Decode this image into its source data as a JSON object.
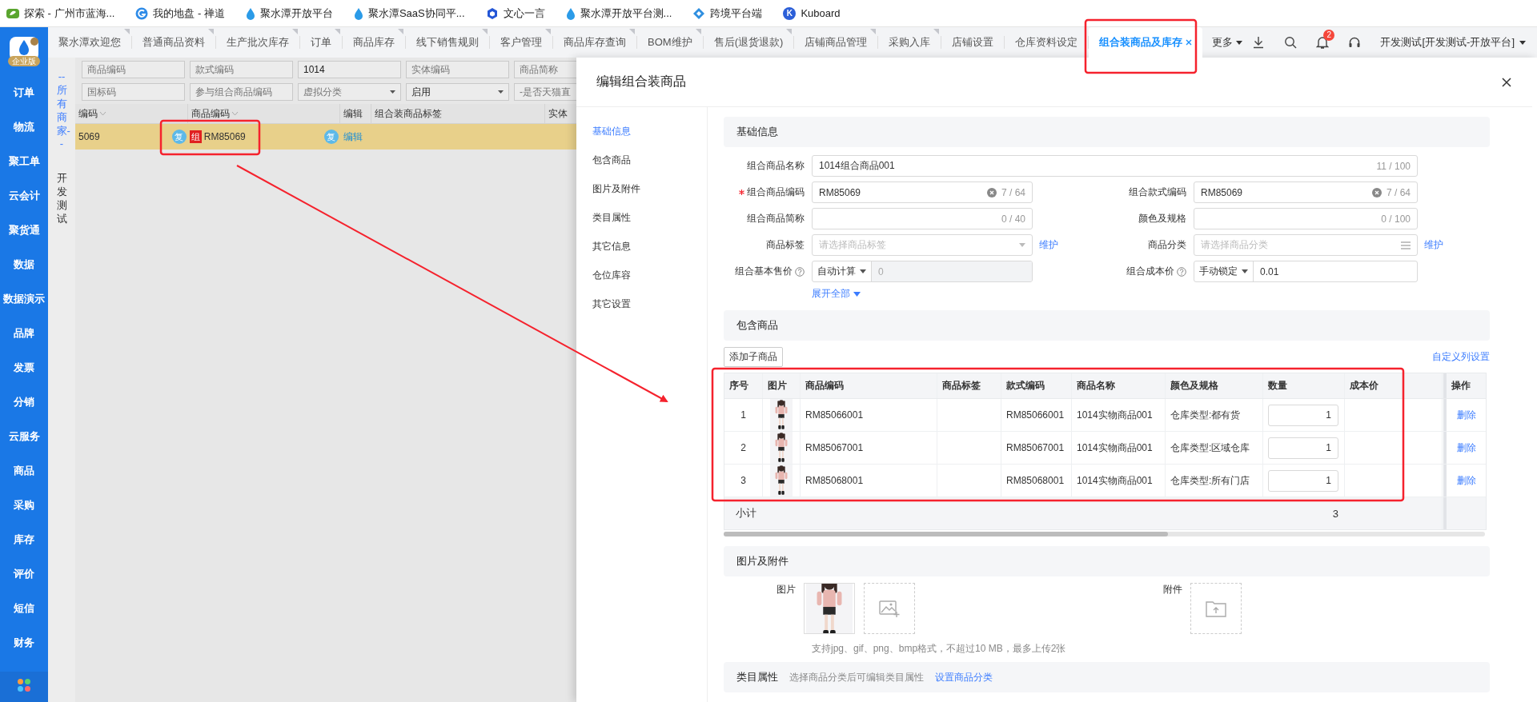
{
  "bookmarks": [
    {
      "kind": "leaf",
      "label": "探索 - 广州市蓝海..."
    },
    {
      "kind": "swirl",
      "label": "我的地盘 - 禅道"
    },
    {
      "kind": "drop",
      "label": "聚水潭开放平台"
    },
    {
      "kind": "drop",
      "label": "聚水潭SaaS协同平..."
    },
    {
      "kind": "cube",
      "label": "文心一言"
    },
    {
      "kind": "drop",
      "label": "聚水潭开放平台测..."
    },
    {
      "kind": "diamond",
      "label": "跨境平台端"
    },
    {
      "kind": "letter",
      "badge": "K",
      "label": "Kuboard"
    }
  ],
  "sidebar": {
    "edition": "企业版",
    "items": [
      "订单",
      "物流",
      "聚工单",
      "云会计",
      "聚货通",
      "数据",
      "数据演示",
      "品牌",
      "发票",
      "分销",
      "云服务",
      "商品",
      "采购",
      "库存",
      "评价",
      "短信",
      "财务"
    ]
  },
  "tabs": [
    {
      "label": "聚水潭欢迎您",
      "marker": true,
      "selected": false
    },
    {
      "label": "普通商品资料",
      "marker": true,
      "selected": false
    },
    {
      "label": "生产批次库存",
      "marker": true,
      "selected": false
    },
    {
      "label": "订单",
      "marker": true,
      "selected": false
    },
    {
      "label": "商品库存",
      "marker": true,
      "selected": false
    },
    {
      "label": "线下销售规则",
      "marker": true,
      "selected": false
    },
    {
      "label": "客户管理",
      "marker": true,
      "selected": false
    },
    {
      "label": "商品库存查询",
      "marker": true,
      "selected": false
    },
    {
      "label": "BOM维护",
      "marker": true,
      "selected": false
    },
    {
      "label": "售后(退货退款)",
      "marker": true,
      "selected": false
    },
    {
      "label": "店铺商品管理",
      "marker": true,
      "selected": false
    },
    {
      "label": "采购入库",
      "marker": true,
      "selected": false
    },
    {
      "label": "店铺设置",
      "marker": false,
      "selected": false
    },
    {
      "label": "仓库资料设定",
      "marker": false,
      "selected": false
    },
    {
      "label": "组合装商品及库存",
      "marker": false,
      "selected": true
    }
  ],
  "more_menu": "更多",
  "notifications": "2",
  "user": "开发测试[开发测试-开放平台]",
  "list_panel": {
    "merchant": "--所有商家--",
    "company": "开发测试",
    "filters": [
      {
        "kind": "text",
        "placeholder": "商品编码"
      },
      {
        "kind": "text",
        "placeholder": "款式编码"
      },
      {
        "kind": "text",
        "value": "1014"
      },
      {
        "kind": "text",
        "placeholder": "实体编码"
      },
      {
        "kind": "text",
        "placeholder": "商品简称"
      },
      {
        "kind": "text",
        "placeholder": "国标码"
      },
      {
        "kind": "text",
        "placeholder": "参与组合商品编码"
      },
      {
        "kind": "select",
        "placeholder": "虚拟分类"
      },
      {
        "kind": "select",
        "value": "启用"
      },
      {
        "kind": "text",
        "placeholder": "-是否天猫直"
      }
    ],
    "columns": [
      {
        "label": "编码",
        "sortable": true
      },
      {
        "label": "商品编码",
        "sortable": true
      },
      {
        "label": "编辑",
        "sortable": false
      },
      {
        "label": "组合装商品标签",
        "sortable": false
      },
      {
        "label": "实体",
        "sortable": false
      }
    ],
    "rows": [
      {
        "selected": true,
        "code_part": "5069",
        "copy_badge": "复",
        "group_badge": "组",
        "code": "RM85069",
        "copy_badge_2": "复",
        "edit": "编辑"
      }
    ]
  },
  "drawer": {
    "title": "编辑组合装商品",
    "nav": [
      {
        "label": "基础信息",
        "selected": true
      },
      {
        "label": "包含商品",
        "selected": false
      },
      {
        "label": "图片及附件",
        "selected": false
      },
      {
        "label": "类目属性",
        "selected": false
      },
      {
        "label": "其它信息",
        "selected": false
      },
      {
        "label": "仓位库容",
        "selected": false
      },
      {
        "label": "其它设置",
        "selected": false
      }
    ],
    "basic_info": {
      "title": "基础信息",
      "expand": "展开全部",
      "fields": [
        {
          "kind": "text",
          "label": "组合商品名称",
          "value": "1014组合商品001",
          "counter": "11 / 100",
          "wide": true
        },
        {
          "kind": "text",
          "label": "组合商品编码",
          "required": true,
          "value": "RM85069",
          "clearable": true,
          "counter": "7 / 64"
        },
        {
          "kind": "text",
          "label": "组合款式编码",
          "value": "RM85069",
          "clearable": true,
          "counter": "7 / 64"
        },
        {
          "kind": "text",
          "label": "组合商品简称",
          "counter": "0 / 40"
        },
        {
          "kind": "text",
          "label": "颜色及规格",
          "counter": "0 / 100"
        },
        {
          "kind": "select",
          "label": "商品标签",
          "placeholder": "请选择商品标签",
          "link": "维护"
        },
        {
          "kind": "list",
          "label": "商品分类",
          "placeholder": "请选择商品分类",
          "link": "维护"
        },
        {
          "kind": "price",
          "label": "组合基本售价",
          "help": true,
          "mode": "自动计算",
          "value": "0",
          "disabled": true
        },
        {
          "kind": "price",
          "label": "组合成本价",
          "help": true,
          "mode": "手动锁定",
          "value": "0.01",
          "disabled": false
        }
      ]
    },
    "items": {
      "title": "包含商品",
      "add_button": "添加子商品",
      "column_settings": "自定义列设置",
      "columns": [
        "序号",
        "图片",
        "商品编码",
        "商品标签",
        "款式编码",
        "商品名称",
        "颜色及规格",
        "数量",
        "成本价",
        "操作"
      ],
      "rows": [
        {
          "index": "1",
          "code": "RM85066001",
          "style_code": "RM85066001",
          "name": "1014实物商品001",
          "spec": "仓库类型:都有货",
          "quantity": "1",
          "action": "删除"
        },
        {
          "index": "2",
          "code": "RM85067001",
          "style_code": "RM85067001",
          "name": "1014实物商品001",
          "spec": "仓库类型:区域仓库",
          "quantity": "1",
          "action": "删除"
        },
        {
          "index": "3",
          "code": "RM85068001",
          "style_code": "RM85068001",
          "name": "1014实物商品001",
          "spec": "仓库类型:所有门店",
          "quantity": "1",
          "action": "删除"
        }
      ],
      "subtotal": {
        "label": "小计",
        "quantity": "3"
      }
    },
    "media": {
      "title": "图片及附件",
      "images_label": "图片",
      "attachments_label": "附件",
      "hint": "支持jpg、gif、png、bmp格式，不超过10 MB，最多上传2张"
    },
    "category": {
      "title": "类目属性",
      "hint": "选择商品分类后可编辑类目属性",
      "link": "设置商品分类"
    }
  }
}
